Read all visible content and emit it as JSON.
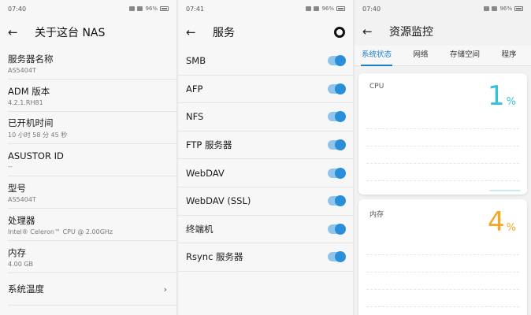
{
  "colors": {
    "accent": "#1b7fd0",
    "toggle_on": "#2a8ed8",
    "cpu": "#34c1dc",
    "memory": "#f5a623"
  },
  "screens": {
    "about": {
      "status_time": "07:40",
      "battery": "96%",
      "title": "关于这台 NAS",
      "items": [
        {
          "label": "服务器名称",
          "value": "AS5404T"
        },
        {
          "label": "ADM 版本",
          "value": "4.2.1.RH81"
        },
        {
          "label": "已开机时间",
          "value": "10 小时 58 分 45 秒"
        },
        {
          "label": "ASUSTOR ID",
          "value": "--"
        },
        {
          "label": "型号",
          "value": "AS5404T"
        },
        {
          "label": "处理器",
          "value": "Intel® Celeron™ CPU @ 2.00GHz"
        },
        {
          "label": "内存",
          "value": "4.00 GB"
        }
      ],
      "nav_item": "系统温度"
    },
    "services": {
      "status_time": "07:41",
      "battery": "96%",
      "title": "服务",
      "items": [
        {
          "label": "SMB",
          "enabled": true
        },
        {
          "label": "AFP",
          "enabled": true
        },
        {
          "label": "NFS",
          "enabled": true
        },
        {
          "label": "FTP 服务器",
          "enabled": true
        },
        {
          "label": "WebDAV",
          "enabled": true
        },
        {
          "label": "WebDAV (SSL)",
          "enabled": true
        },
        {
          "label": "终端机",
          "enabled": true
        },
        {
          "label": "Rsync 服务器",
          "enabled": true
        }
      ]
    },
    "monitor": {
      "status_time": "07:40",
      "battery": "96%",
      "title": "资源监控",
      "tabs": [
        "系统状态",
        "网络",
        "存储空间",
        "程序"
      ],
      "active_tab": 0,
      "cpu": {
        "label": "CPU",
        "value": "1",
        "unit": "%"
      },
      "memory": {
        "label": "内存",
        "value": "4",
        "unit": "%"
      }
    }
  }
}
